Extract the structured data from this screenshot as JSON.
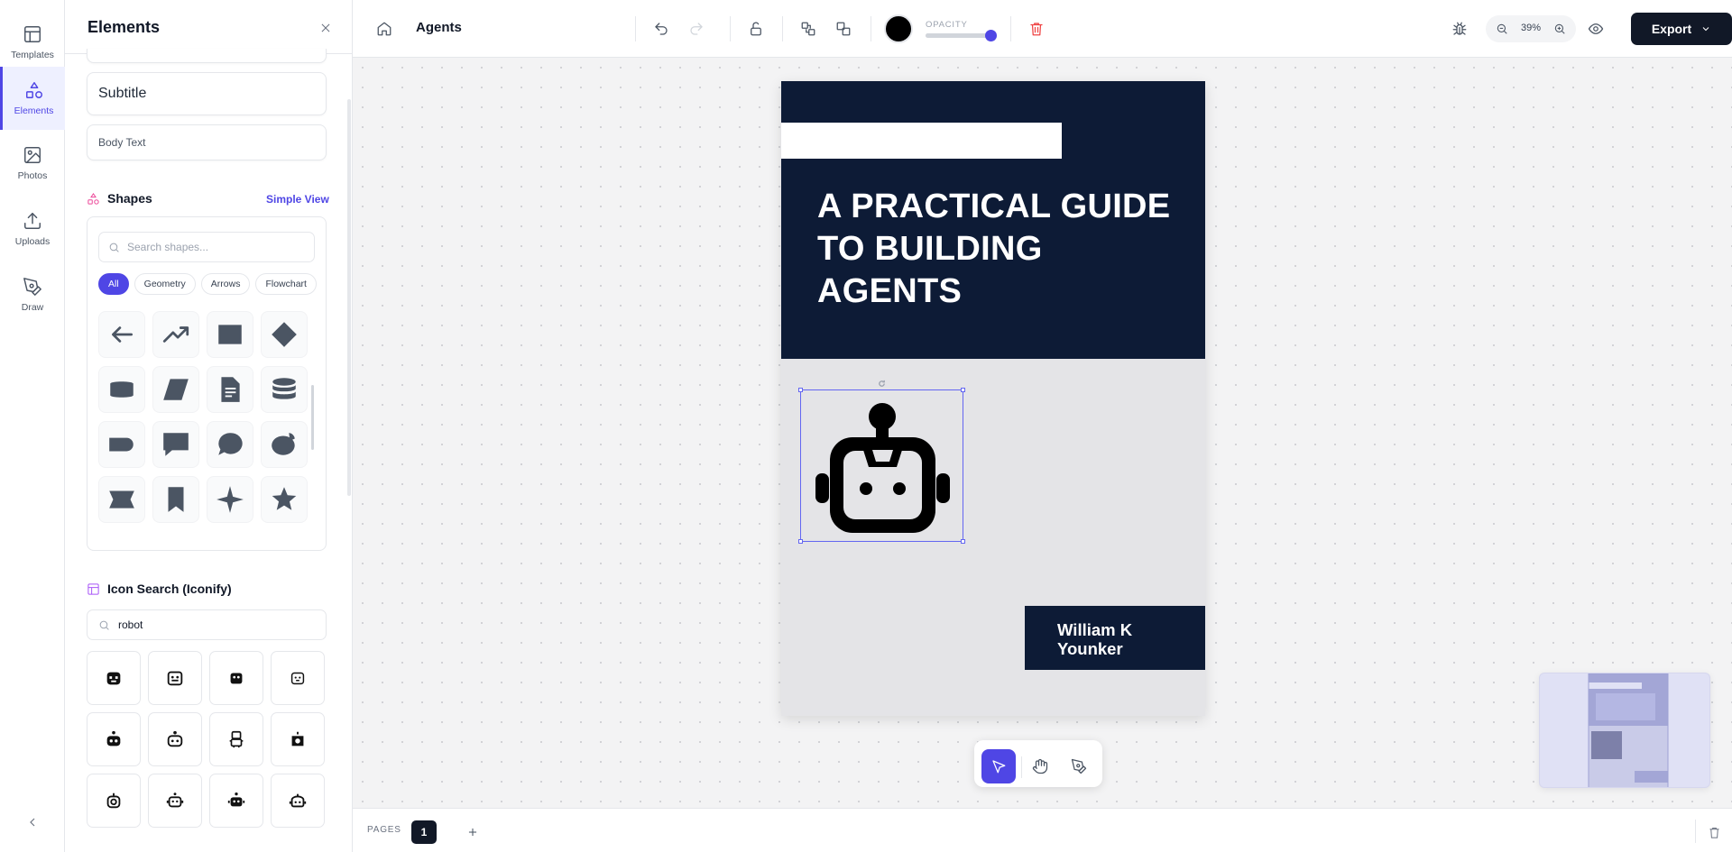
{
  "rail": {
    "items": [
      {
        "label": "Templates",
        "icon": "layout-icon"
      },
      {
        "label": "Elements",
        "icon": "shapes-icon",
        "active": true
      },
      {
        "label": "Photos",
        "icon": "image-icon"
      },
      {
        "label": "Uploads",
        "icon": "upload-icon"
      },
      {
        "label": "Draw",
        "icon": "pen-icon"
      }
    ]
  },
  "panel": {
    "title": "Elements",
    "text_presets": {
      "subtitle": "Subtitle",
      "body": "Body Text"
    },
    "shapes": {
      "title": "Shapes",
      "simple_view": "Simple View",
      "search_placeholder": "Search shapes...",
      "categories": [
        "All",
        "Geometry",
        "Arrows",
        "Flowchart"
      ],
      "active_category": "All",
      "items": [
        "arrow-left",
        "trend-up",
        "rectangle",
        "diamond",
        "cylinder",
        "parallelogram",
        "document",
        "database",
        "delay",
        "speech-bubble-square",
        "speech-bubble-round",
        "thought-bubble",
        "banner",
        "bookmark",
        "star-four",
        "star-five"
      ]
    },
    "icon_search": {
      "title": "Icon Search (Iconify)",
      "query": "robot",
      "results": 12
    }
  },
  "topbar": {
    "document_title": "Agents",
    "opacity_label": "OPACITY",
    "opacity_value": 1.0,
    "color": "#000000",
    "zoom": "39%",
    "export_label": "Export"
  },
  "canvas": {
    "cover_title": "A PRACTICAL GUIDE TO BUILDING AGENTS",
    "author": "William K Younker",
    "cover_color": "#0d1b36",
    "page_bg": "#e4e4e7"
  },
  "bottombar": {
    "pages_label": "PAGES",
    "current_page": "1"
  },
  "colors": {
    "accent": "#4f46e5",
    "danger": "#ef4444",
    "dark": "#111827"
  }
}
